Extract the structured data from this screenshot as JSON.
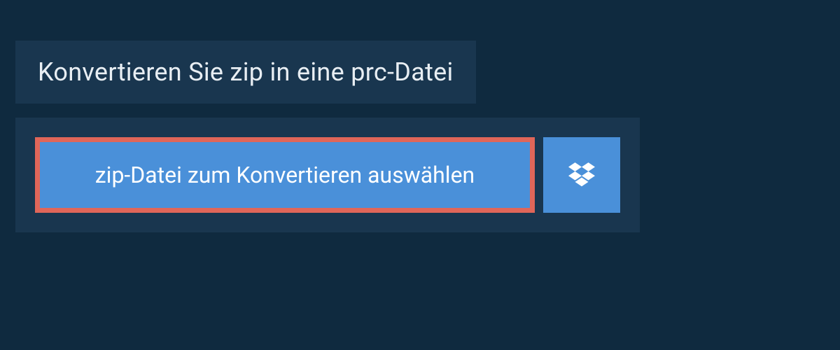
{
  "header": {
    "title": "Konvertieren Sie zip in eine prc-Datei"
  },
  "upload": {
    "select_button_label": "zip-Datei zum Konvertieren auswählen"
  },
  "colors": {
    "background": "#0f2a3f",
    "panel": "#19364f",
    "button_primary": "#4a90d9",
    "button_highlight_border": "#e06659",
    "text_light": "#ffffff"
  }
}
